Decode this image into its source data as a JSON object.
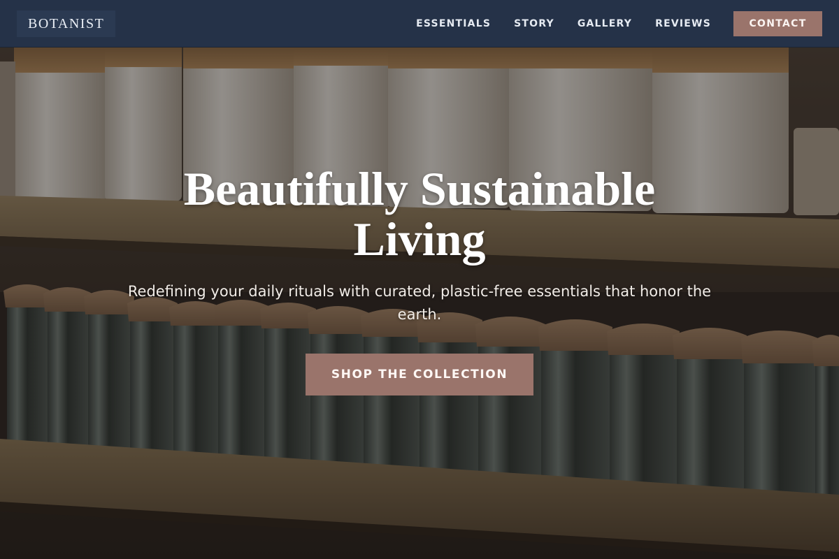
{
  "header": {
    "logo": "BOTANIST",
    "nav": [
      "ESSENTIALS",
      "STORY",
      "GALLERY",
      "REVIEWS"
    ],
    "contact_label": "CONTACT"
  },
  "hero": {
    "headline_line1": "Beautifully Sustainable",
    "headline_line2": "Living",
    "subhead": "Redefining your daily rituals with curated, plastic-free essentials that honor the earth.",
    "cta_label": "SHOP THE COLLECTION",
    "background": "photo of storage jars on wooden shelves"
  },
  "colors": {
    "nav_background": "#253248",
    "accent": "#9a746b",
    "headline_text": "#ffffff",
    "shelf_wood": "#6b5a45"
  }
}
